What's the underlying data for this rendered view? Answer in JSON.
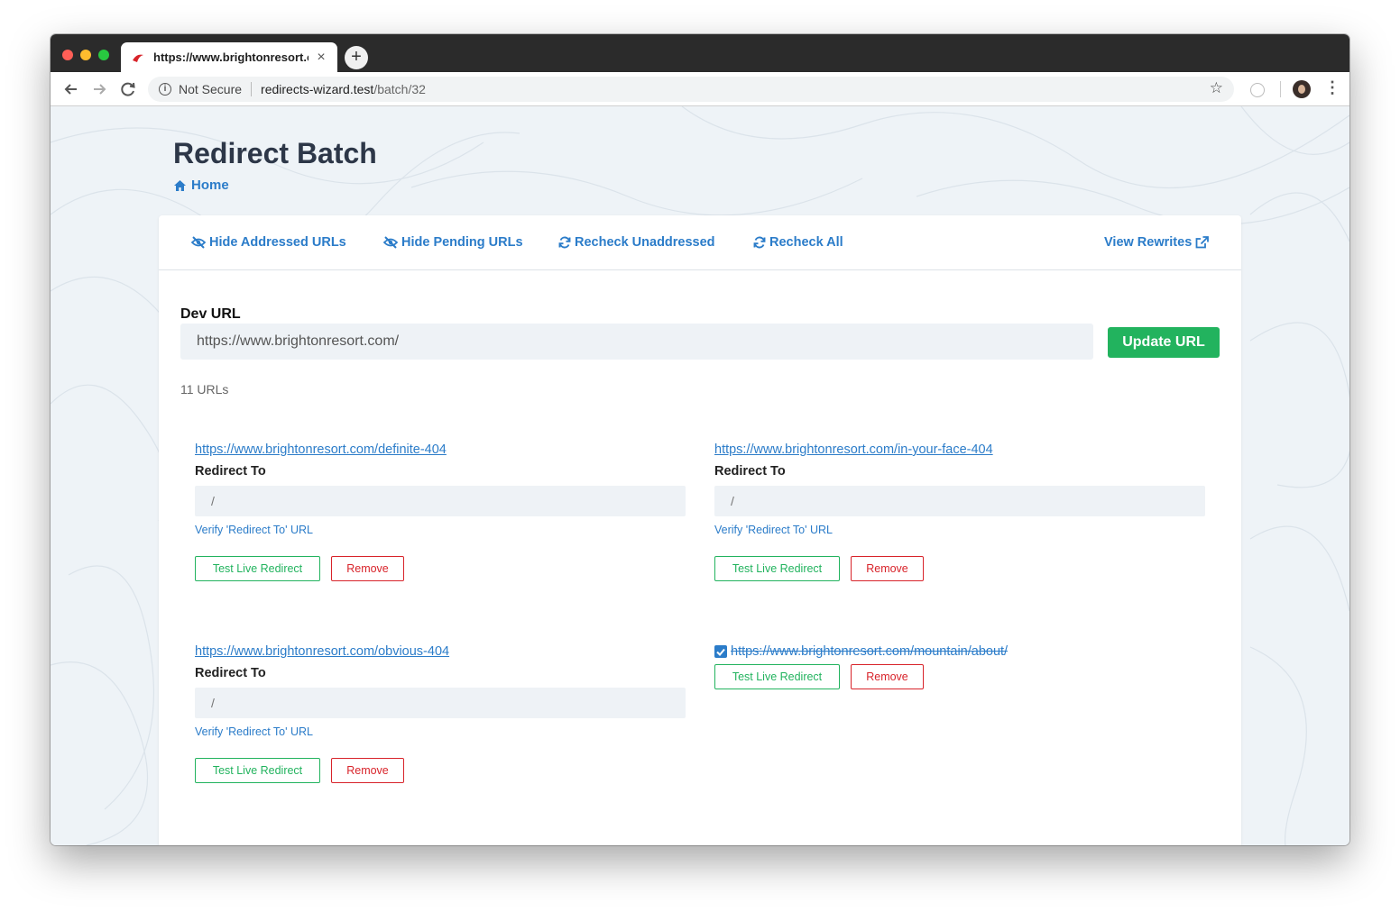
{
  "browser": {
    "tab_title": "https://www.brightonresort.com/",
    "tab_close": "×",
    "new_tab": "+",
    "security_text": "Not Secure",
    "url_host": "redirects-wizard.test",
    "url_path": "/batch/32",
    "icons": [
      "back-arrow-icon",
      "forward-arrow-icon",
      "reload-icon",
      "info-icon",
      "star-icon",
      "extension-icon",
      "avatar",
      "menu-dots-icon"
    ]
  },
  "page": {
    "title": "Redirect Batch",
    "home_label": "Home"
  },
  "actions": {
    "hide_addressed": "Hide Addressed URLs",
    "hide_pending": "Hide Pending URLs",
    "recheck_unaddressed": "Recheck Unaddressed",
    "recheck_all": "Recheck All",
    "view_rewrites": "View Rewrites"
  },
  "dev": {
    "label": "Dev URL",
    "value": "https://www.brightonresort.com/",
    "update_button": "Update URL"
  },
  "url_count": "11 URLs",
  "items": [
    {
      "url": "https://www.brightonresort.com/definite-404",
      "redirect_label": "Redirect To",
      "redirect_placeholder": "/",
      "verify_label": "Verify 'Redirect To' URL",
      "test_label": "Test Live Redirect",
      "remove_label": "Remove",
      "addressed": false
    },
    {
      "url": "https://www.brightonresort.com/in-your-face-404",
      "redirect_label": "Redirect To",
      "redirect_placeholder": "/",
      "verify_label": "Verify 'Redirect To' URL",
      "test_label": "Test Live Redirect",
      "remove_label": "Remove",
      "addressed": false
    },
    {
      "url": "https://www.brightonresort.com/obvious-404",
      "redirect_label": "Redirect To",
      "redirect_placeholder": "/",
      "verify_label": "Verify 'Redirect To' URL",
      "test_label": "Test Live Redirect",
      "remove_label": "Remove",
      "addressed": false
    },
    {
      "url": "https://www.brightonresort.com/mountain/about/",
      "test_label": "Test Live Redirect",
      "remove_label": "Remove",
      "addressed": true
    }
  ],
  "colors": {
    "link": "#2b7cc9",
    "success": "#22b35e",
    "danger": "#d8232a",
    "page_bg": "#eef3f7"
  }
}
